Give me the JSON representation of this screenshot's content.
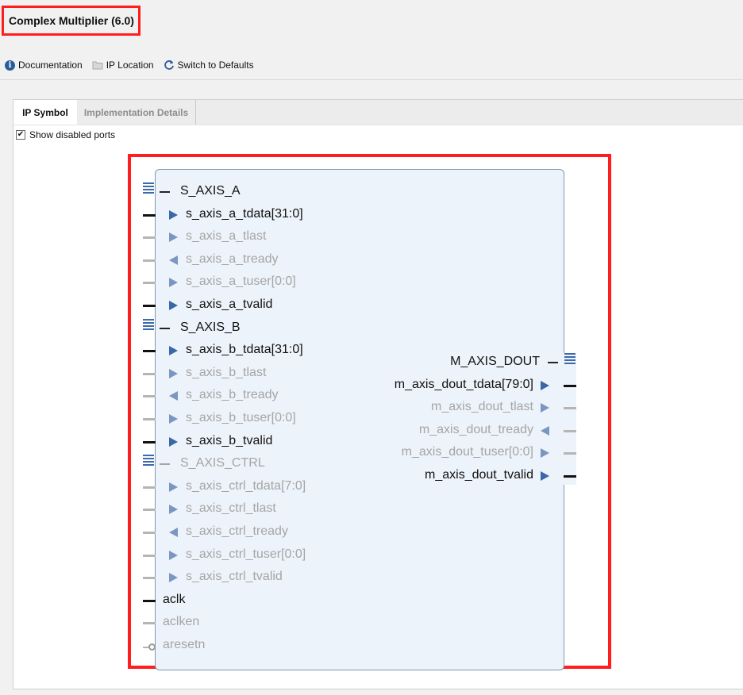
{
  "header": {
    "title": "Complex Multiplier (6.0)"
  },
  "toolbar": {
    "documentation": "Documentation",
    "ip_location": "IP Location",
    "switch_defaults": "Switch to Defaults"
  },
  "tabs": [
    {
      "label": "IP Symbol"
    },
    {
      "label": "Implementation Details"
    }
  ],
  "show_disabled": {
    "label": "Show disabled ports",
    "checked": true
  },
  "symbol": {
    "left_buses": [
      {
        "name": "S_AXIS_A",
        "enabled": true,
        "ports": [
          {
            "name": "s_axis_a_tdata[31:0]",
            "dir": "in",
            "enabled": true
          },
          {
            "name": "s_axis_a_tlast",
            "dir": "in",
            "enabled": false
          },
          {
            "name": "s_axis_a_tready",
            "dir": "out",
            "enabled": false
          },
          {
            "name": "s_axis_a_tuser[0:0]",
            "dir": "in",
            "enabled": false
          },
          {
            "name": "s_axis_a_tvalid",
            "dir": "in",
            "enabled": true
          }
        ]
      },
      {
        "name": "S_AXIS_B",
        "enabled": true,
        "ports": [
          {
            "name": "s_axis_b_tdata[31:0]",
            "dir": "in",
            "enabled": true
          },
          {
            "name": "s_axis_b_tlast",
            "dir": "in",
            "enabled": false
          },
          {
            "name": "s_axis_b_tready",
            "dir": "out",
            "enabled": false
          },
          {
            "name": "s_axis_b_tuser[0:0]",
            "dir": "in",
            "enabled": false
          },
          {
            "name": "s_axis_b_tvalid",
            "dir": "in",
            "enabled": true
          }
        ]
      },
      {
        "name": "S_AXIS_CTRL",
        "enabled": false,
        "ports": [
          {
            "name": "s_axis_ctrl_tdata[7:0]",
            "dir": "in",
            "enabled": false
          },
          {
            "name": "s_axis_ctrl_tlast",
            "dir": "in",
            "enabled": false
          },
          {
            "name": "s_axis_ctrl_tready",
            "dir": "out",
            "enabled": false
          },
          {
            "name": "s_axis_ctrl_tuser[0:0]",
            "dir": "in",
            "enabled": false
          },
          {
            "name": "s_axis_ctrl_tvalid",
            "dir": "in",
            "enabled": false
          }
        ]
      }
    ],
    "left_pins": [
      {
        "name": "aclk",
        "enabled": true
      },
      {
        "name": "aclken",
        "enabled": false
      },
      {
        "name": "aresetn",
        "enabled": false
      }
    ],
    "right_bus": {
      "name": "M_AXIS_DOUT",
      "enabled": true,
      "ports": [
        {
          "name": "m_axis_dout_tdata[79:0]",
          "dir": "out",
          "enabled": true
        },
        {
          "name": "m_axis_dout_tlast",
          "dir": "out",
          "enabled": false
        },
        {
          "name": "m_axis_dout_tready",
          "dir": "in",
          "enabled": false
        },
        {
          "name": "m_axis_dout_tuser[0:0]",
          "dir": "out",
          "enabled": false
        },
        {
          "name": "m_axis_dout_tvalid",
          "dir": "out",
          "enabled": true
        }
      ]
    }
  }
}
